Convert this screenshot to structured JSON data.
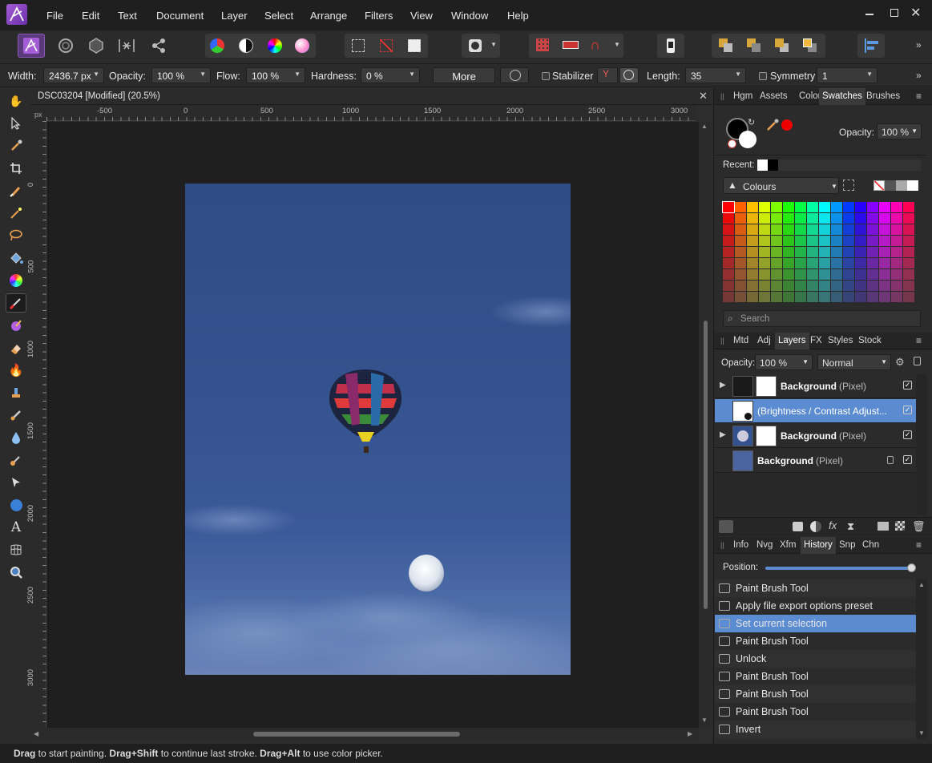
{
  "menu": {
    "items": [
      "File",
      "Edit",
      "Text",
      "Document",
      "Layer",
      "Select",
      "Arrange",
      "Filters",
      "View",
      "Window",
      "Help"
    ]
  },
  "context_bar": {
    "width_label": "Width:",
    "width_value": "2436.7 px",
    "opacity_label": "Opacity:",
    "opacity_value": "100 %",
    "flow_label": "Flow:",
    "flow_value": "100 %",
    "hardness_label": "Hardness:",
    "hardness_value": "0 %",
    "more_label": "More",
    "stabilizer_label": "Stabilizer",
    "length_label": "Length:",
    "length_value": "35",
    "symmetry_label": "Symmetry",
    "symmetry_value": "1"
  },
  "document": {
    "tab_title": "DSC03204 [Modified] (20.5%)",
    "ruler_unit": "px",
    "h_ticks": [
      "-500",
      "0",
      "500",
      "1000",
      "1500",
      "2000",
      "2500",
      "3000"
    ],
    "v_ticks": [
      "0",
      "500",
      "1000",
      "1500",
      "2000",
      "2500",
      "3000"
    ]
  },
  "swatches_panel": {
    "tabs": [
      "Hgm",
      "Assets",
      "Color",
      "Swatches",
      "Brushes"
    ],
    "active_tab": "Swatches",
    "opacity_label": "Opacity:",
    "opacity_value": "100 %",
    "recent_label": "Recent:",
    "palette_name": "Colours",
    "search_placeholder": "Search"
  },
  "layers_panel": {
    "tabs": [
      "Mtd",
      "Adj",
      "Layers",
      "FX",
      "Styles",
      "Stock"
    ],
    "active_tab": "Layers",
    "opacity_label": "Opacity:",
    "opacity_value": "100 %",
    "blend_mode": "Normal",
    "layers": [
      {
        "name": "Background",
        "type": "(Pixel)"
      },
      {
        "name": "",
        "type": "(Brightness / Contrast Adjust..."
      },
      {
        "name": "Background",
        "type": "(Pixel)"
      },
      {
        "name": "Background",
        "type": "(Pixel)"
      }
    ]
  },
  "history_panel": {
    "tabs": [
      "Info",
      "Nvg",
      "Xfm",
      "History",
      "Snp",
      "Chn"
    ],
    "active_tab": "History",
    "position_label": "Position:",
    "position_fraction": 0.97,
    "items": [
      "Paint Brush Tool",
      "Apply file export options preset",
      "Set current selection",
      "Paint Brush Tool",
      "Unlock",
      "Paint Brush Tool",
      "Paint Brush Tool",
      "Paint Brush Tool",
      "Invert"
    ],
    "selected_index": 2
  },
  "status": {
    "b1": "Drag",
    "t1": " to start painting. ",
    "b2": "Drag+Shift",
    "t2": " to continue last stroke. ",
    "b3": "Drag+Alt",
    "t3": " to use color picker."
  },
  "colors": {
    "accent": "#5b8bd0",
    "photo_sky": "#34528d"
  }
}
